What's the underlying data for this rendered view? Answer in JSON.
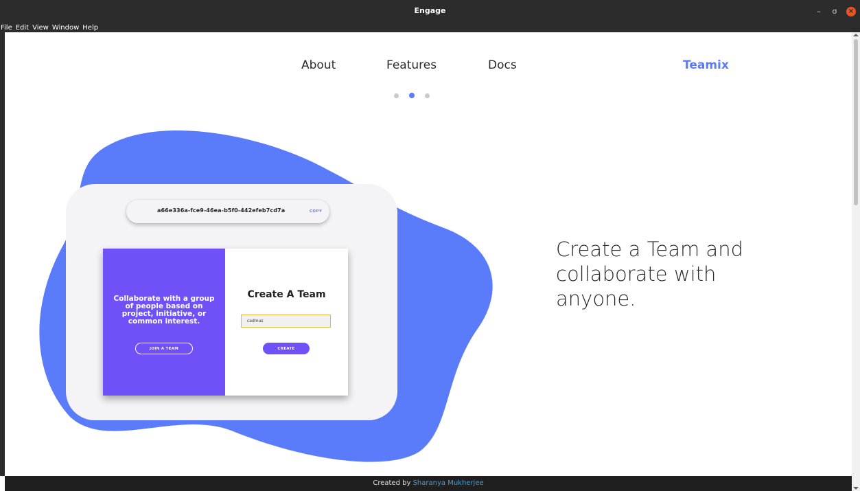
{
  "window": {
    "title": "Engage",
    "controls": {
      "minimize": "–",
      "maximize": "σ",
      "close": "×"
    }
  },
  "menubar": {
    "items": [
      "File",
      "Edit",
      "View",
      "Window",
      "Help"
    ]
  },
  "nav": {
    "items": [
      "About",
      "Features",
      "Docs"
    ],
    "brand": "Teamix"
  },
  "carousel": {
    "count": 3,
    "active_index": 1
  },
  "team_card": {
    "team_id": "a66e336a-fce9-46ea-b5f0-442efeb7cd7a",
    "copy_label": "COPY",
    "left_panel": {
      "message": "Collaborate with a group of people based on project, initiative, or common interest.",
      "join_label": "JOIN A TEAM"
    },
    "right_panel": {
      "heading": "Create A Team",
      "input_value": "cadmus",
      "create_label": "CREATE"
    }
  },
  "headline": "Create a Team and collaborate with anyone.",
  "footer": {
    "prefix": "Created by",
    "author": "Sharanya Mukherjee"
  },
  "colors": {
    "accent": "#5b7cfa",
    "purple": "#7051f8",
    "input_border": "#e8b93a",
    "close_button": "#e95420"
  }
}
